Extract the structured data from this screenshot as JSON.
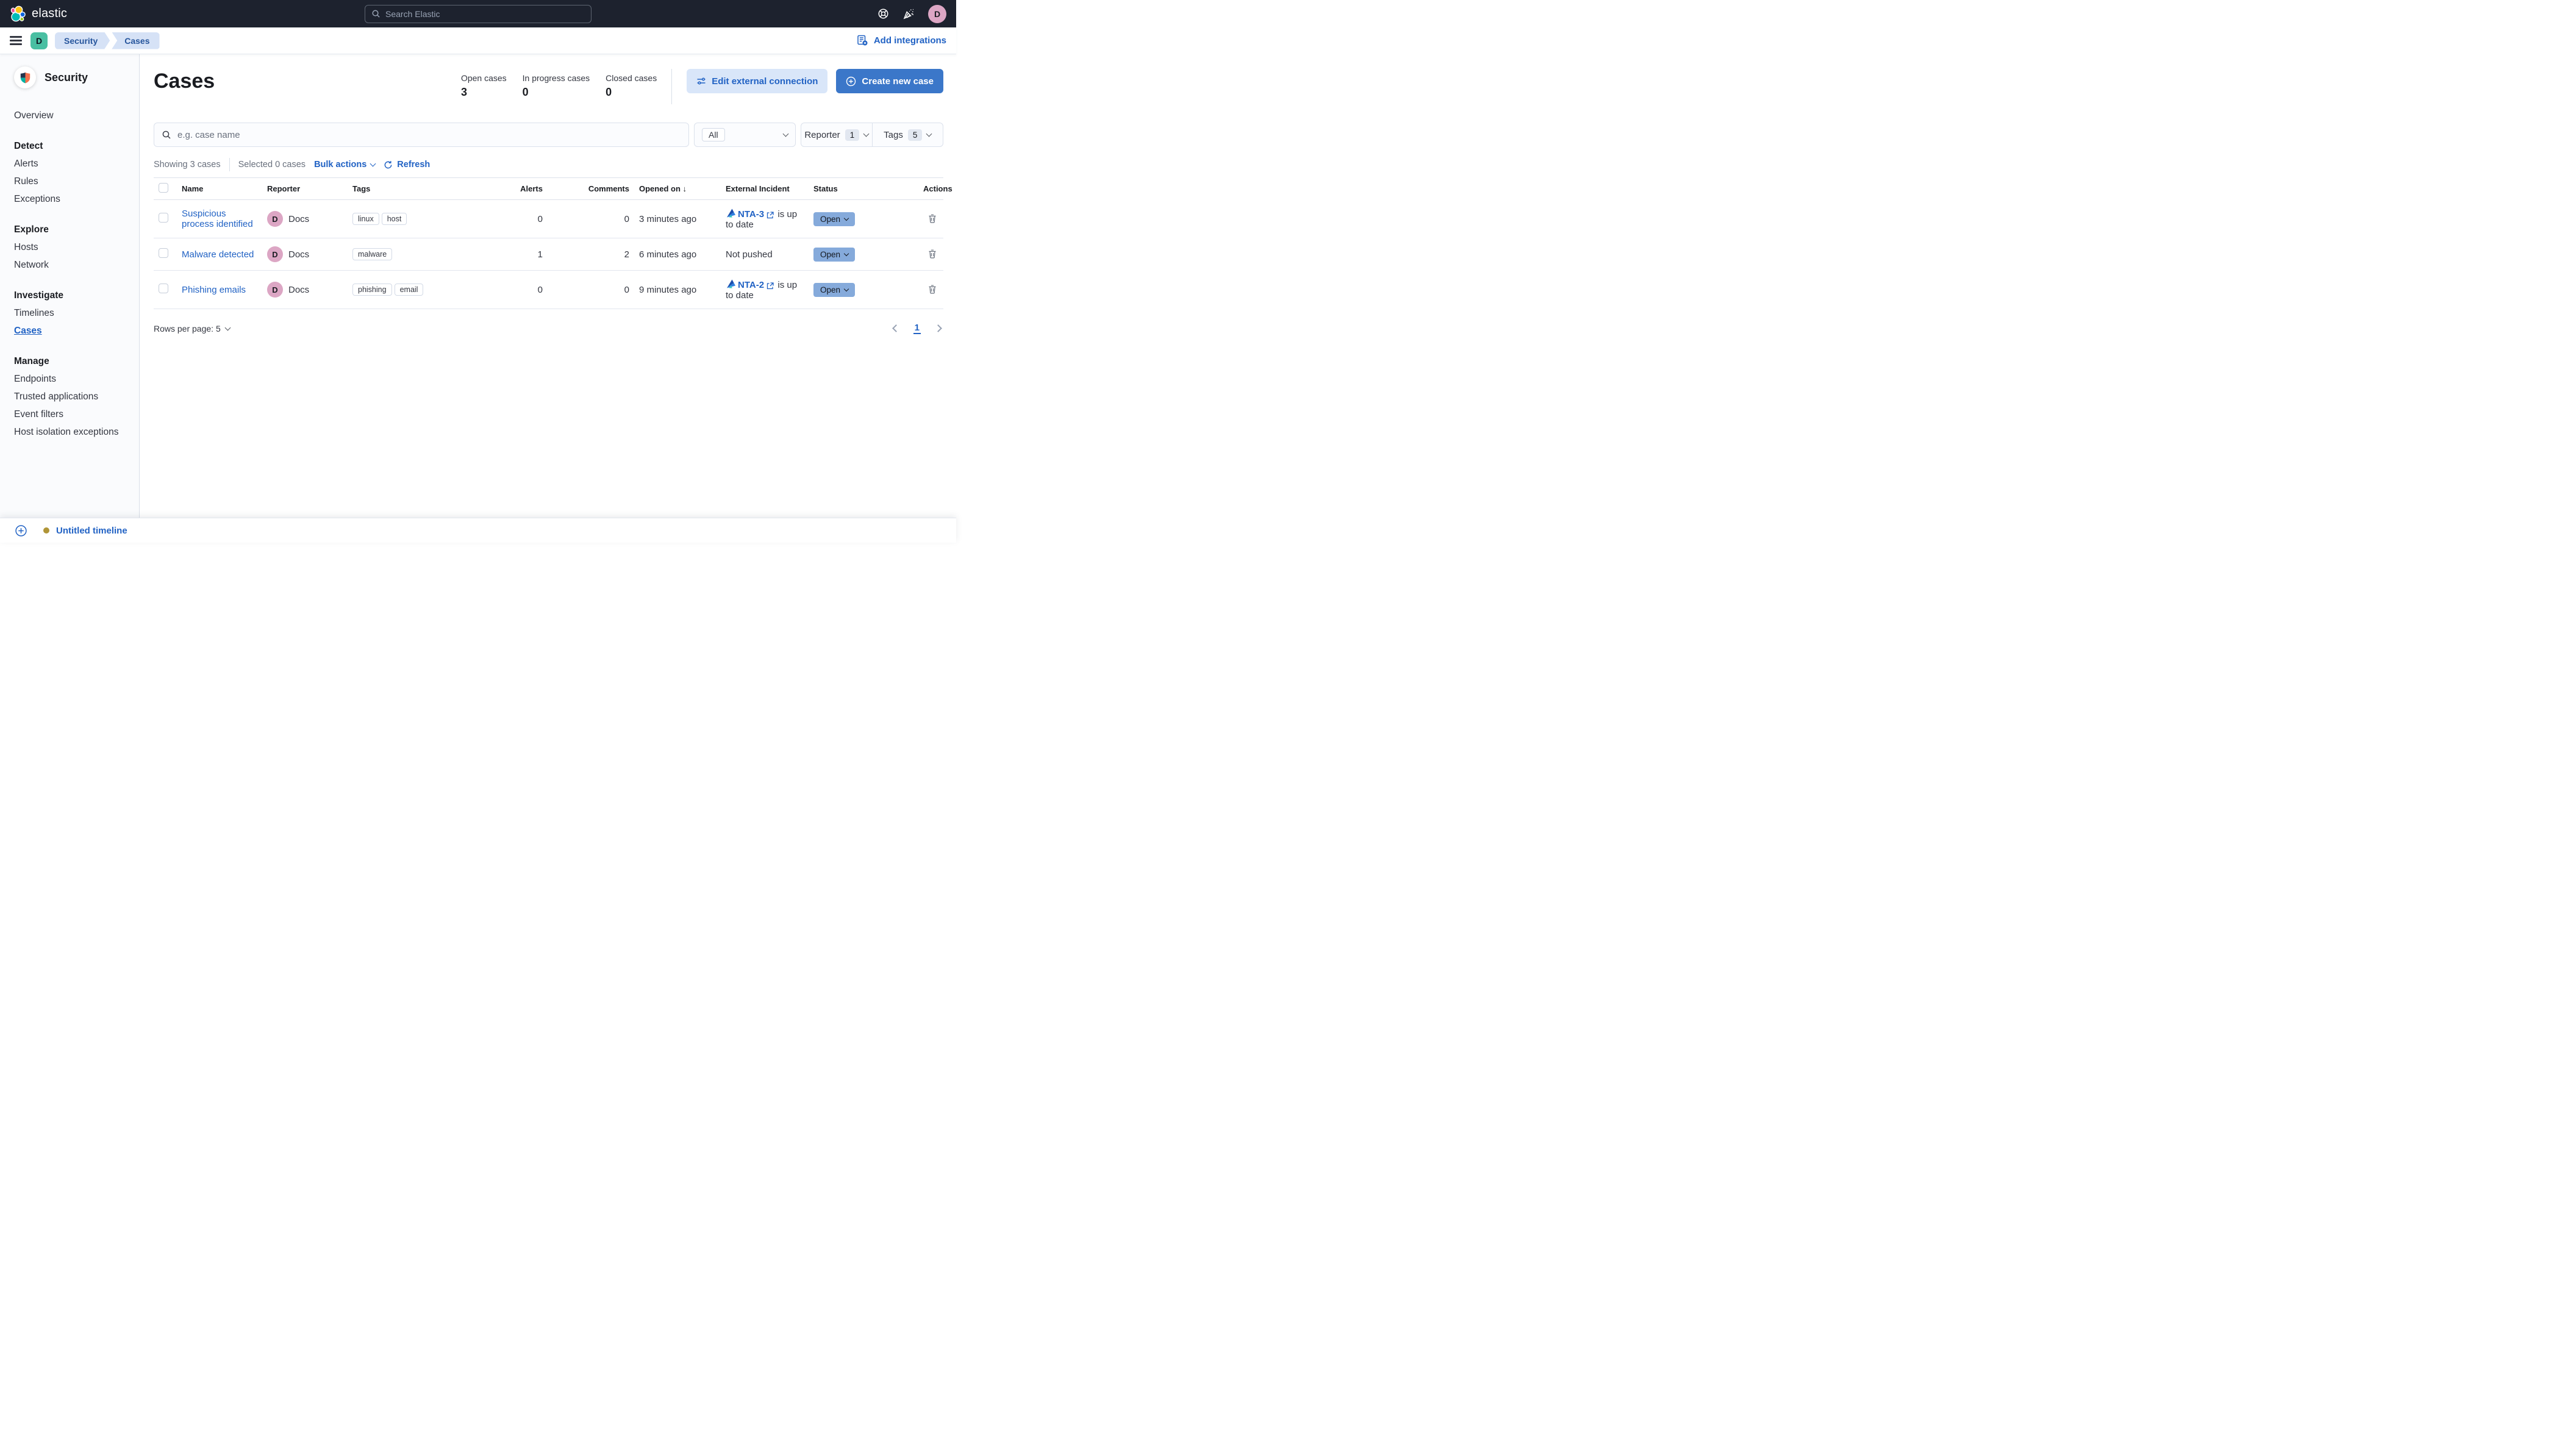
{
  "topbar": {
    "brand": "elastic",
    "search_placeholder": "Search Elastic",
    "avatar_initial": "D"
  },
  "navbar": {
    "space_initial": "D",
    "breadcrumbs": [
      "Security",
      "Cases"
    ],
    "add_integrations_label": "Add integrations"
  },
  "sidebar": {
    "title": "Security",
    "sections": [
      {
        "items": [
          "Overview"
        ]
      },
      {
        "heading": "Detect",
        "items": [
          "Alerts",
          "Rules",
          "Exceptions"
        ]
      },
      {
        "heading": "Explore",
        "items": [
          "Hosts",
          "Network"
        ]
      },
      {
        "heading": "Investigate",
        "items": [
          "Timelines",
          "Cases"
        ]
      },
      {
        "heading": "Manage",
        "items": [
          "Endpoints",
          "Trusted applications",
          "Event filters",
          "Host isolation exceptions"
        ]
      }
    ],
    "active_item": "Cases"
  },
  "page": {
    "title": "Cases",
    "stats": [
      {
        "label": "Open cases",
        "value": "3"
      },
      {
        "label": "In progress cases",
        "value": "0"
      },
      {
        "label": "Closed cases",
        "value": "0"
      }
    ],
    "edit_external_label": "Edit external connection",
    "create_case_label": "Create new case"
  },
  "filters": {
    "search_placeholder": "e.g. case name",
    "status_selected": "All",
    "reporter_label": "Reporter",
    "reporter_count": "1",
    "tags_label": "Tags",
    "tags_count": "5"
  },
  "toolbar": {
    "showing": "Showing 3 cases",
    "selected": "Selected 0 cases",
    "bulk_actions": "Bulk actions",
    "refresh": "Refresh"
  },
  "table": {
    "columns": [
      "Name",
      "Reporter",
      "Tags",
      "Alerts",
      "Comments",
      "Opened on",
      "External Incident",
      "Status",
      "Actions"
    ],
    "sort_indicator": "↓",
    "rows": [
      {
        "name": "Suspicious process identified",
        "reporter": "Docs",
        "reporter_initial": "D",
        "tags": [
          "linux",
          "host"
        ],
        "alerts": "0",
        "comments": "0",
        "opened_on": "3 minutes ago",
        "external": {
          "link": "NTA-3",
          "text": "is up to date"
        },
        "status": "Open"
      },
      {
        "name": "Malware detected",
        "reporter": "Docs",
        "reporter_initial": "D",
        "tags": [
          "malware"
        ],
        "alerts": "1",
        "comments": "2",
        "opened_on": "6 minutes ago",
        "external": {
          "text": "Not pushed"
        },
        "status": "Open"
      },
      {
        "name": "Phishing emails",
        "reporter": "Docs",
        "reporter_initial": "D",
        "tags": [
          "phishing",
          "email"
        ],
        "alerts": "0",
        "comments": "0",
        "opened_on": "9 minutes ago",
        "external": {
          "link": "NTA-2",
          "text": "is up to date"
        },
        "status": "Open"
      }
    ]
  },
  "footer": {
    "rows_per_page": "Rows per page: 5",
    "page_number": "1"
  },
  "timeline_bar": {
    "label": "Untitled timeline"
  },
  "colors": {
    "topbar_bg": "#1d222e",
    "accent_blue": "#2162c4",
    "primary_button_bg": "#3b77c9",
    "soft_button_bg": "#d9e6f9",
    "breadcrumb_bg": "#d6e2f6",
    "space_badge_bg": "#49bfa2",
    "avatar_pink": "#dca6c4",
    "open_badge_bg": "#85aadb",
    "timeline_dot": "#b09537"
  }
}
